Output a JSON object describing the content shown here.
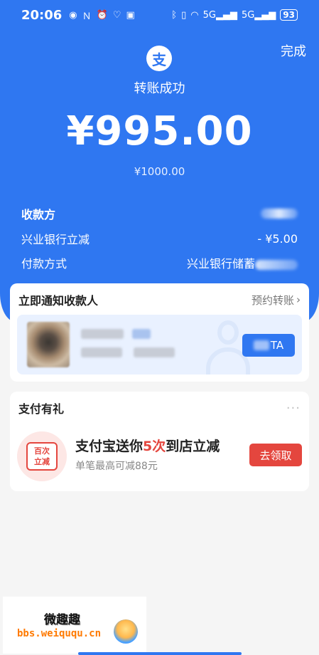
{
  "status_bar": {
    "time": "20:06",
    "left_icons": [
      "eye-icon",
      "nfc-icon",
      "alarm-icon",
      "health-icon",
      "app-badge-icon"
    ],
    "right_icons": [
      "bluetooth-icon",
      "vibrate-icon",
      "wifi-icon",
      "signal-5g-icon",
      "signal-5g-icon-2"
    ],
    "signal_label_1": "5G",
    "signal_label_2": "5G",
    "battery": "93"
  },
  "header": {
    "done_label": "完成",
    "logo_glyph": "支",
    "status": "转账成功",
    "amount": "¥995.00",
    "original_amount": "¥1000.00"
  },
  "details": {
    "payee_label": "收款方",
    "discount_label": "兴业银行立减",
    "discount_value": "- ¥5.00",
    "payment_label": "付款方式",
    "payment_value": "兴业银行储蓄"
  },
  "notify": {
    "title": "立即通知收款人",
    "scheduled_label": "预约转账",
    "button_tail": "TA"
  },
  "gift": {
    "title": "支付有礼",
    "badge_line1": "百次",
    "badge_line2": "立减",
    "promo_prefix": "支付宝送你",
    "promo_highlight": "5次",
    "promo_suffix": "到店立减",
    "promo_sub": "单笔最高可减88元",
    "claim_label": "去领取"
  },
  "watermark": {
    "title": "微趣趣",
    "url": "bbs.weiququ.cn"
  },
  "colors": {
    "brand_blue": "#2f77f1",
    "accent_red": "#e4463e",
    "background": "#f5f5f5"
  }
}
